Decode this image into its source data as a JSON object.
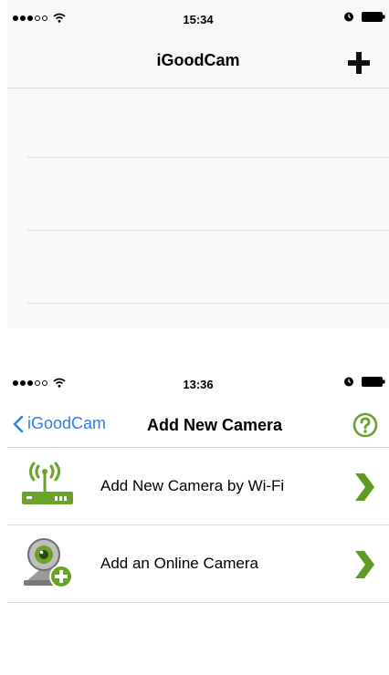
{
  "screen1": {
    "status": {
      "time": "15:34"
    },
    "navbar": {
      "title": "iGoodCam",
      "add_icon": "plus-icon"
    }
  },
  "screen2": {
    "status": {
      "time": "13:36"
    },
    "navbar": {
      "back_label": "iGoodCam",
      "title": "Add New Camera",
      "help_icon": "question-icon"
    },
    "menu": [
      {
        "label": "Add New Camera by Wi-Fi",
        "icon": "wifi-router-icon"
      },
      {
        "label": "Add an Online Camera",
        "icon": "webcam-add-icon"
      }
    ]
  },
  "colors": {
    "accent_blue": "#2f7ff0",
    "icon_green": "#6aa22a",
    "chevron_green": "#5f9a22",
    "separator": "#dcdcdc"
  }
}
